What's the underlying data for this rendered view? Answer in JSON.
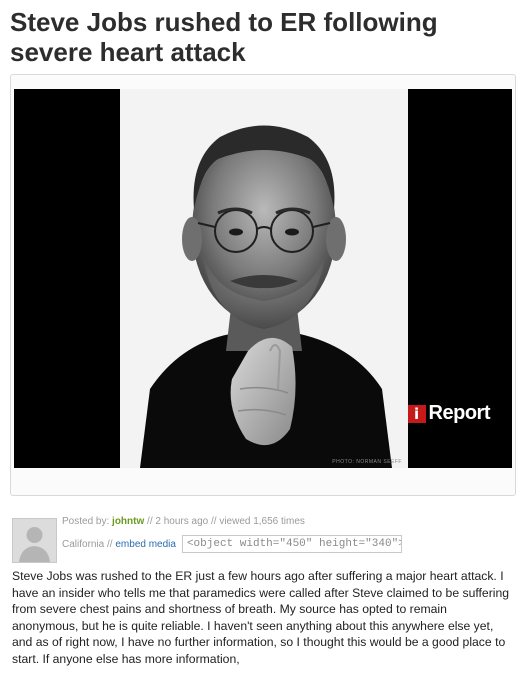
{
  "article": {
    "title": "Steve Jobs rushed to ER following severe heart attack"
  },
  "media": {
    "logo_mark": "i",
    "logo_text": "Report",
    "photo_credit": "PHOTO: NORMAN SEEFF"
  },
  "post": {
    "posted_by_label": "Posted by:",
    "author": "johntw",
    "time_info": "// 2 hours ago // viewed 1,656 times",
    "location": "California //",
    "embed_link": "embed media",
    "embed_code": "<object width=\"450\" height=\"340\">"
  },
  "body": {
    "text": "Steve Jobs was rushed to the ER just a few hours ago after suffering a major heart attack. I have an insider who tells me that paramedics were called after Steve claimed to be suffering from severe chest pains and shortness of breath. My source has opted to remain anonymous, but he is quite reliable. I haven't seen anything about this anywhere else yet, and as of right now, I have no further information, so I thought this would be a good place to start. If anyone else has more information,"
  }
}
